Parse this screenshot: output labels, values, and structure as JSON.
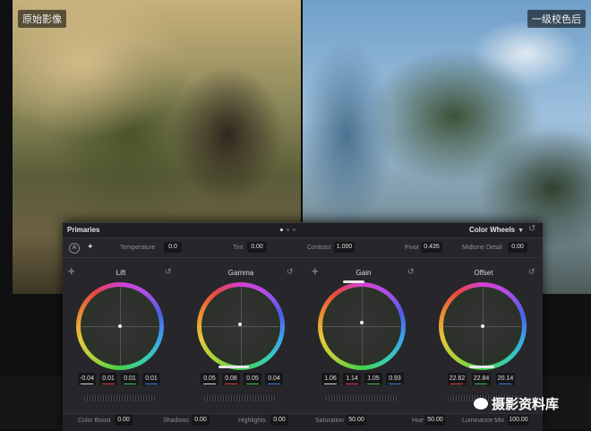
{
  "photo": {
    "left_label": "原始影像",
    "right_label": "一级校色后"
  },
  "panel": {
    "title": "Primaries",
    "mode": "Color Wheels",
    "page_count": 3,
    "active_page": 1
  },
  "params": {
    "temperature": {
      "label": "Temperature",
      "value": "0.0"
    },
    "tint": {
      "label": "Tint",
      "value": "0.00"
    },
    "contrast": {
      "label": "Contrast",
      "value": "1.000"
    },
    "pivot": {
      "label": "Pivot",
      "value": "0.435"
    },
    "midtone_detail": {
      "label": "Midtone Detail",
      "value": "0.00"
    }
  },
  "wheels": {
    "lift": {
      "title": "Lift",
      "values": [
        "-0.04",
        "0.01",
        "0.01",
        "0.01"
      ]
    },
    "gamma": {
      "title": "Gamma",
      "values": [
        "0.05",
        "0.08",
        "0.05",
        "0.04"
      ]
    },
    "gain": {
      "title": "Gain",
      "values": [
        "1.06",
        "1.14",
        "1.05",
        "0.93"
      ]
    },
    "offset": {
      "title": "Offset",
      "values": [
        "22.62",
        "22.84",
        "20.14"
      ]
    }
  },
  "channel_colors": [
    "#d8d8d8",
    "#e04040",
    "#3fbf45",
    "#3f7fe0"
  ],
  "bottom_params": {
    "color_boost": {
      "label": "Color Boost",
      "value": "0.00"
    },
    "shadows": {
      "label": "Shadows",
      "value": "0.00"
    },
    "highlights": {
      "label": "Highlights",
      "value": "0.00"
    },
    "saturation": {
      "label": "Saturation",
      "value": "50.00"
    },
    "hue": {
      "label": "Hue",
      "value": "50.00"
    },
    "luminance_mix": {
      "label": "Luminance Mix",
      "value": "100.00"
    }
  },
  "watermark": "摄影资料库",
  "icons": [
    "auto-balance-icon",
    "color-picker-icon",
    "reset-icon",
    "crosshair-icon",
    "chevron-down-icon",
    "wechat-icon"
  ]
}
